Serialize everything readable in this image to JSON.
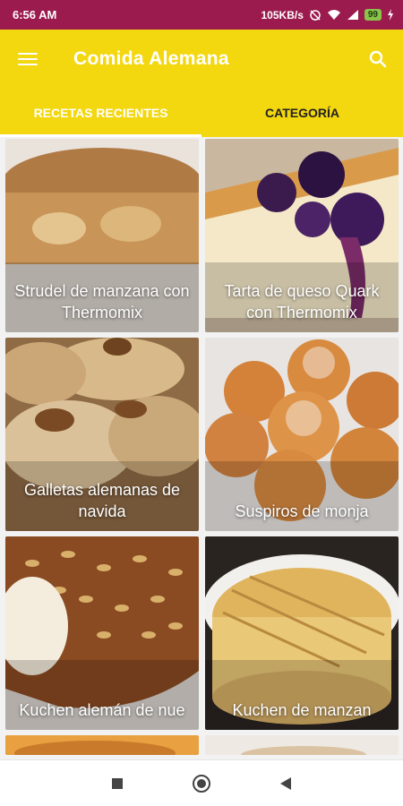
{
  "status": {
    "time": "6:56 AM",
    "speed": "105KB/s",
    "battery": "99"
  },
  "appbar": {
    "title": "Comida Alemana"
  },
  "tabs": [
    {
      "label": "RECETAS RECIENTES",
      "active": true
    },
    {
      "label": "CATEGORÍA",
      "active": false
    }
  ],
  "recipes": [
    {
      "title": "Strudel de manzana con Thermomix"
    },
    {
      "title": "Tarta de queso Quark con Thermomix"
    },
    {
      "title": "Galletas alemanas de navida"
    },
    {
      "title": "Suspiros de monja"
    },
    {
      "title": "Kuchen alemán de nue"
    },
    {
      "title": "Kuchen de manzan"
    }
  ],
  "colors": {
    "status_bar": "#9c1b4f",
    "accent": "#f3d70f"
  },
  "icons": {
    "menu": "menu-icon",
    "search": "search-icon",
    "nav_recents": "square-icon",
    "nav_home": "circle-icon",
    "nav_back": "triangle-back-icon"
  }
}
